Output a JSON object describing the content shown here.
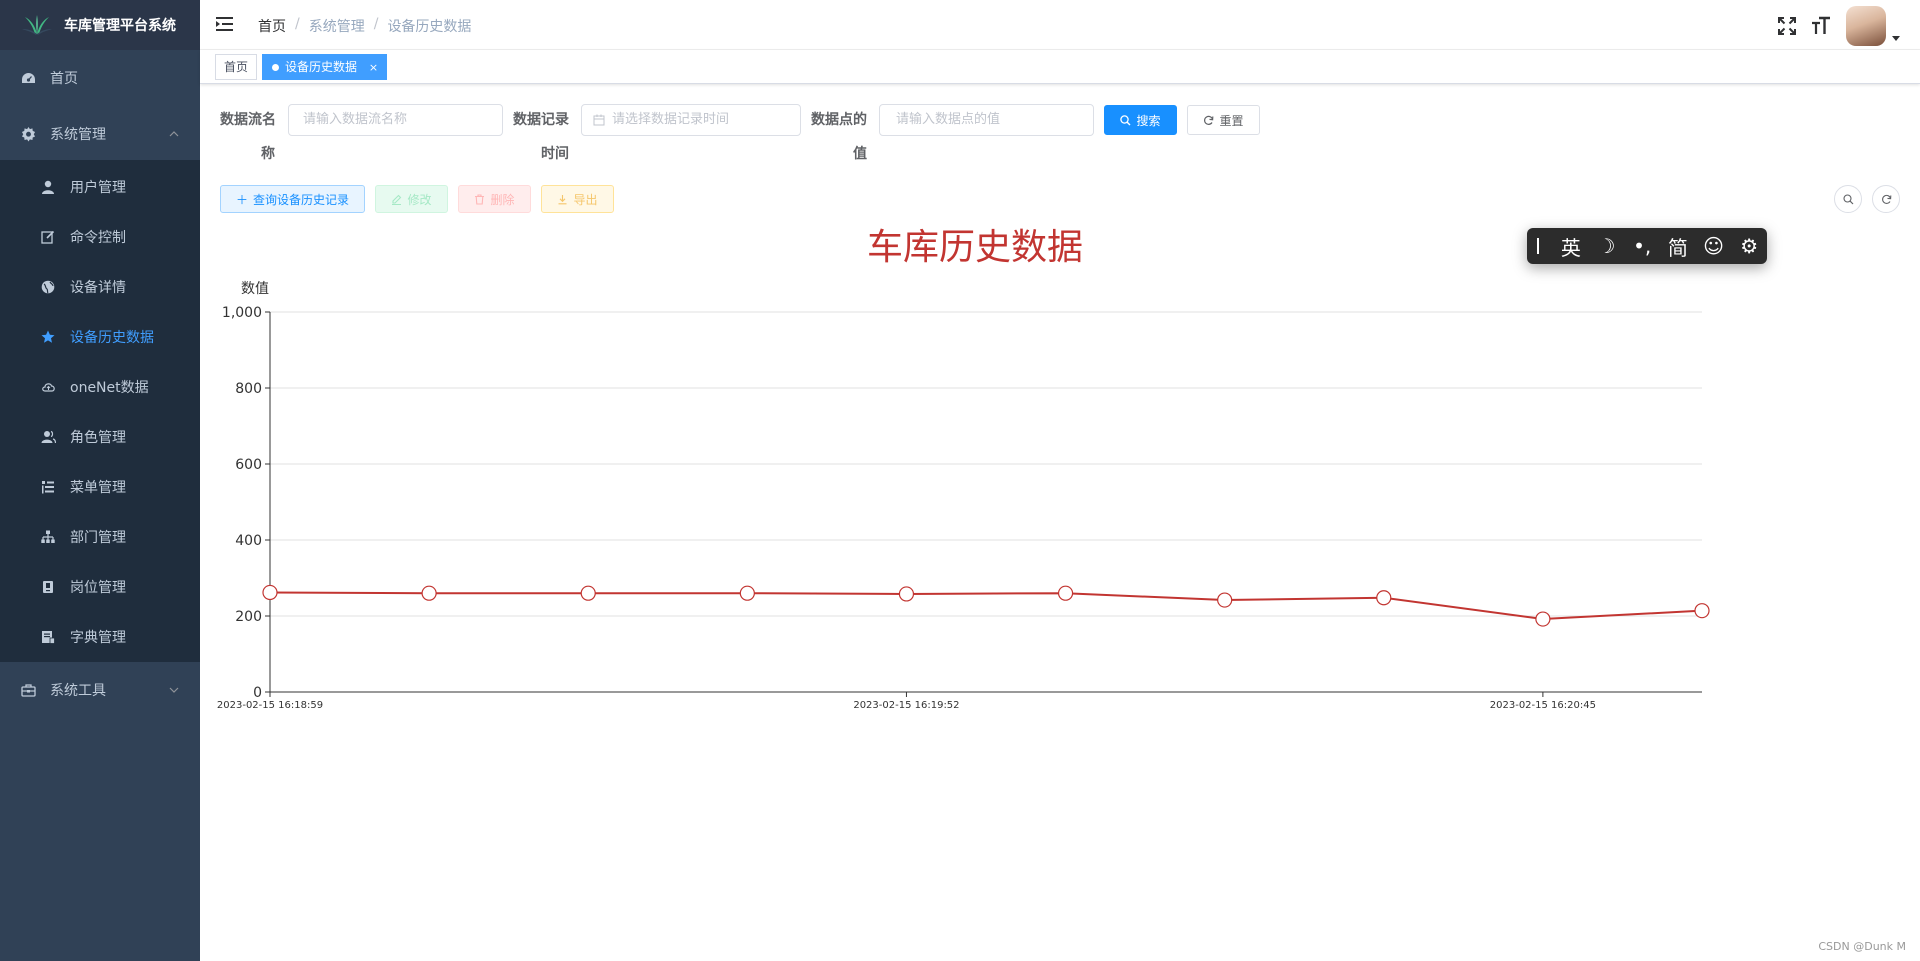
{
  "app": {
    "title": "车库管理平台系统"
  },
  "sidebar": {
    "items": [
      {
        "label": "首页",
        "icon": "dashboard-icon"
      },
      {
        "label": "系统管理",
        "icon": "gear-icon"
      },
      {
        "label": "用户管理",
        "icon": "user-icon"
      },
      {
        "label": "命令控制",
        "icon": "edit-icon"
      },
      {
        "label": "设备详情",
        "icon": "globe-icon"
      },
      {
        "label": "设备历史数据",
        "icon": "star-icon",
        "active": true
      },
      {
        "label": "oneNet数据",
        "icon": "cloud-icon"
      },
      {
        "label": "角色管理",
        "icon": "peoples-icon"
      },
      {
        "label": "菜单管理",
        "icon": "tree-table-icon"
      },
      {
        "label": "部门管理",
        "icon": "tree-icon"
      },
      {
        "label": "岗位管理",
        "icon": "post-icon"
      },
      {
        "label": "字典管理",
        "icon": "dict-icon"
      },
      {
        "label": "系统工具",
        "icon": "tool-icon"
      }
    ]
  },
  "navbar": {
    "breadcrumb": [
      "首页",
      "系统管理",
      "设备历史数据"
    ]
  },
  "tags": {
    "items": [
      {
        "label": "首页"
      },
      {
        "label": "设备历史数据",
        "close": "×"
      }
    ]
  },
  "search": {
    "fields": [
      {
        "label_line1": "数据流名",
        "label_line2": "称",
        "placeholder": "请输入数据流名称"
      },
      {
        "label_line1": "数据记录",
        "label_line2": "时间",
        "placeholder": "请选择数据记录时间"
      },
      {
        "label_line1": "数据点的",
        "label_line2": "值",
        "placeholder": "请输入数据点的值"
      }
    ],
    "search_label": "搜索",
    "reset_label": "重置"
  },
  "toolbar": {
    "query_label": "查询设备历史记录",
    "edit_label": "修改",
    "delete_label": "删除",
    "export_label": "导出"
  },
  "ime": {
    "items": [
      "英",
      "☽",
      "•,",
      "简",
      "☺",
      "⚙"
    ]
  },
  "chart_data": {
    "type": "line",
    "title": "车库历史数据",
    "ylabel": "数值",
    "xlabel": "",
    "ylim": [
      0,
      1000
    ],
    "yticks": [
      0,
      200,
      400,
      600,
      800,
      1000
    ],
    "ytick_labels": [
      "0",
      "200",
      "400",
      "600",
      "800",
      "1,000"
    ],
    "x_tick_labels": [
      "2023-02-15 16:18:59",
      "2023-02-15 16:19:52",
      "2023-02-15 16:20:45"
    ],
    "x_tick_positions": [
      0,
      4,
      8
    ],
    "values": [
      262,
      260,
      260,
      260,
      258,
      260,
      242,
      248,
      192,
      214
    ],
    "grid": true,
    "series_color": "#c23531"
  },
  "watermark": "CSDN @Dunk M"
}
